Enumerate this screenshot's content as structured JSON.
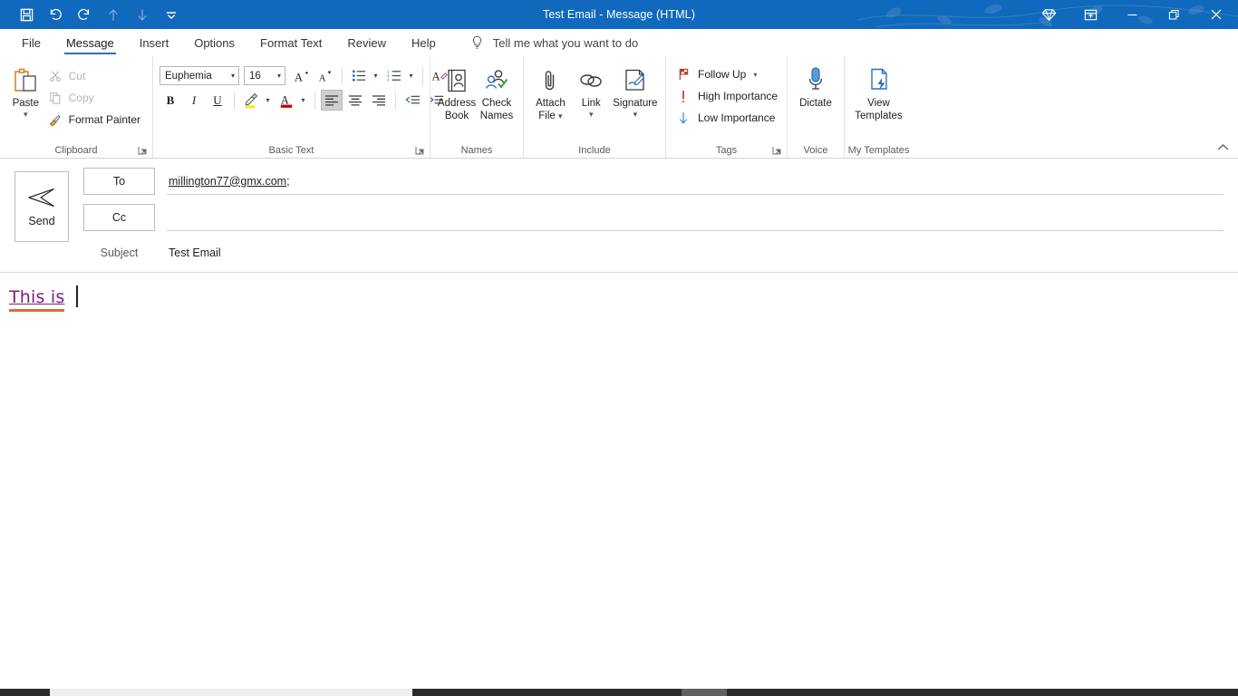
{
  "window": {
    "title": "Test Email  -  Message (HTML)",
    "accent_color": "#1069bc",
    "quick_access": [
      {
        "name": "save-icon",
        "label": "Save",
        "disabled": false
      },
      {
        "name": "undo-icon",
        "label": "Undo",
        "disabled": false
      },
      {
        "name": "redo-icon",
        "label": "Redo",
        "disabled": false
      },
      {
        "name": "previous-item-icon",
        "label": "Previous Item",
        "disabled": true
      },
      {
        "name": "next-item-icon",
        "label": "Next Item",
        "disabled": true
      },
      {
        "name": "customize-quick-access-toolbar-icon",
        "label": "Customize Quick Access Toolbar",
        "disabled": false
      }
    ],
    "controls": [
      {
        "name": "premium-diamond-icon",
        "label": "Microsoft 365"
      },
      {
        "name": "ribbon-display-options-icon",
        "label": "Ribbon Display Options"
      },
      {
        "name": "minimize-icon",
        "label": "Minimize"
      },
      {
        "name": "restore-icon",
        "label": "Restore Down"
      },
      {
        "name": "close-icon",
        "label": "Close"
      }
    ]
  },
  "tabs": [
    {
      "label": "File",
      "active": false
    },
    {
      "label": "Message",
      "active": true
    },
    {
      "label": "Insert",
      "active": false
    },
    {
      "label": "Options",
      "active": false
    },
    {
      "label": "Format Text",
      "active": false
    },
    {
      "label": "Review",
      "active": false
    },
    {
      "label": "Help",
      "active": false
    }
  ],
  "tellme": {
    "icon": "lightbulb-icon",
    "placeholder": "Tell me what you want to do"
  },
  "ribbon": {
    "collapse_label": "Collapse the Ribbon",
    "clipboard": {
      "group_label": "Clipboard",
      "paste_label": "Paste",
      "cut_label": "Cut",
      "copy_label": "Copy",
      "format_painter_label": "Format Painter",
      "cut_disabled": true,
      "copy_disabled": true
    },
    "basic_text": {
      "group_label": "Basic Text",
      "font_name": "Euphemia",
      "font_size": "16",
      "grow_font_label": "Increase Font Size",
      "shrink_font_label": "Decrease Font Size",
      "bullets_label": "Bullets",
      "numbering_label": "Numbering",
      "clear_formatting_label": "Clear All Formatting",
      "bold_label": "B",
      "italic_label": "I",
      "underline_label": "U",
      "highlight_label": "Text Highlight Color",
      "highlight_color": "#ffe600",
      "font_color_label": "Font Color",
      "font_color": "#c00000",
      "align_left_label": "Align Left",
      "align_center_label": "Center",
      "align_right_label": "Align Right",
      "decrease_indent_label": "Decrease Indent",
      "increase_indent_label": "Increase Indent",
      "align_left_active": true
    },
    "names": {
      "group_label": "Names",
      "address_book_line1": "Address",
      "address_book_line2": "Book",
      "check_names_line1": "Check",
      "check_names_line2": "Names"
    },
    "include": {
      "group_label": "Include",
      "attach_file_line1": "Attach",
      "attach_file_line2": "File",
      "link_label": "Link",
      "signature_label": "Signature"
    },
    "tags": {
      "group_label": "Tags",
      "follow_up_label": "Follow Up",
      "high_importance_label": "High Importance",
      "low_importance_label": "Low Importance"
    },
    "voice": {
      "group_label": "Voice",
      "dictate_label": "Dictate"
    },
    "my_templates": {
      "group_label": "My Templates",
      "view_templates_line1": "View",
      "view_templates_line2": "Templates"
    }
  },
  "compose": {
    "send_label": "Send",
    "to_label": "To",
    "to_value": "millington77@gmx.com;",
    "cc_label": "Cc",
    "cc_value": "",
    "subject_label": "Subject",
    "subject_value": "Test Email",
    "body_text": "This  is",
    "body_text_color": "#7b1f87",
    "body_spellcheck_color": "#d4682a"
  }
}
